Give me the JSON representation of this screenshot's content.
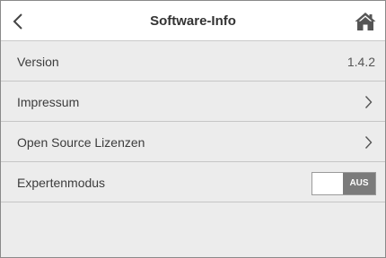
{
  "header": {
    "title": "Software-Info",
    "back_icon": "chevron-left-icon",
    "home_icon": "home-icon"
  },
  "rows": [
    {
      "label": "Version",
      "value": "1.4.2"
    },
    {
      "label": "Impressum",
      "icon": "chevron-right-icon"
    },
    {
      "label": "Open Source Lizenzen",
      "icon": "chevron-right-icon"
    },
    {
      "label": "Expertenmodus",
      "toggle": {
        "state_label": "AUS",
        "on": false
      }
    }
  ],
  "colors": {
    "background": "#ececec",
    "header_background": "#ffffff",
    "toggle_off": "#7b7b7b",
    "text": "#3c3c3c"
  }
}
